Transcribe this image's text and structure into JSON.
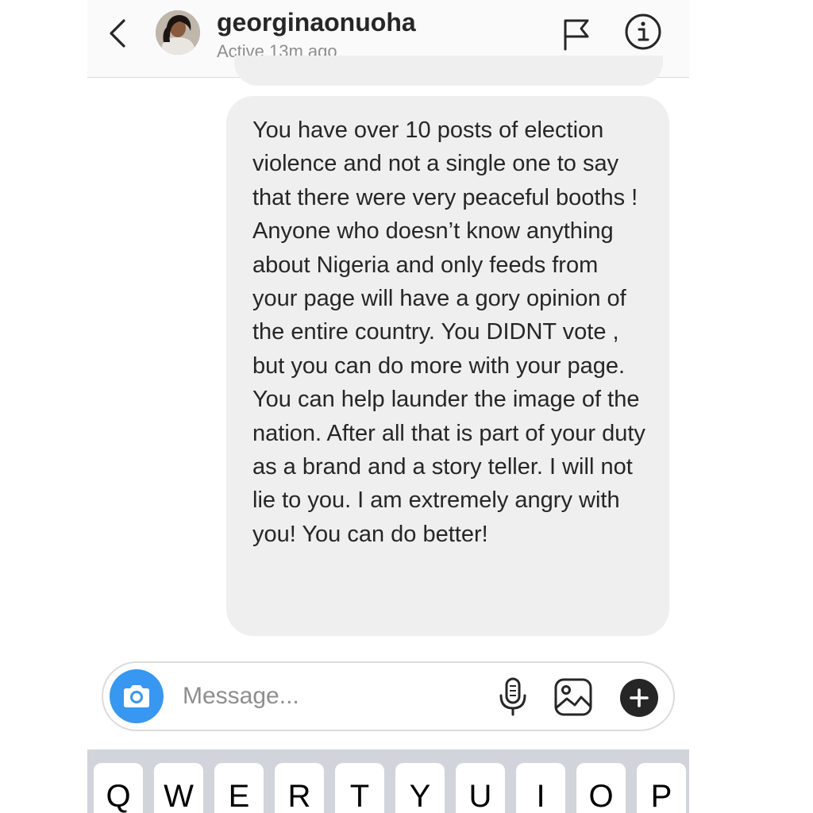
{
  "header": {
    "username": "georginaonuoha",
    "status": "Active 13m ago"
  },
  "message": {
    "text": "You have over 10 posts of election violence and not a single one to say that there were very peaceful booths ! Anyone who doesn’t know anything about Nigeria and only feeds from your page will have a gory opinion of the entire country. You DIDNT vote , but you can do more with your page. You can help launder the image of the nation. After all that is part of your duty as a brand and a story teller. I will not lie to you. I am extremely angry with you! You can do better!"
  },
  "composer": {
    "placeholder": "Message..."
  },
  "keyboard": {
    "keys": [
      "Q",
      "W",
      "E",
      "R",
      "T",
      "Y",
      "U",
      "I",
      "O",
      "P"
    ]
  },
  "colors": {
    "accent": "#3897f0",
    "bubble": "#efefef",
    "header_bg": "#fafafa",
    "keyboard_bg": "#d1d4da"
  }
}
